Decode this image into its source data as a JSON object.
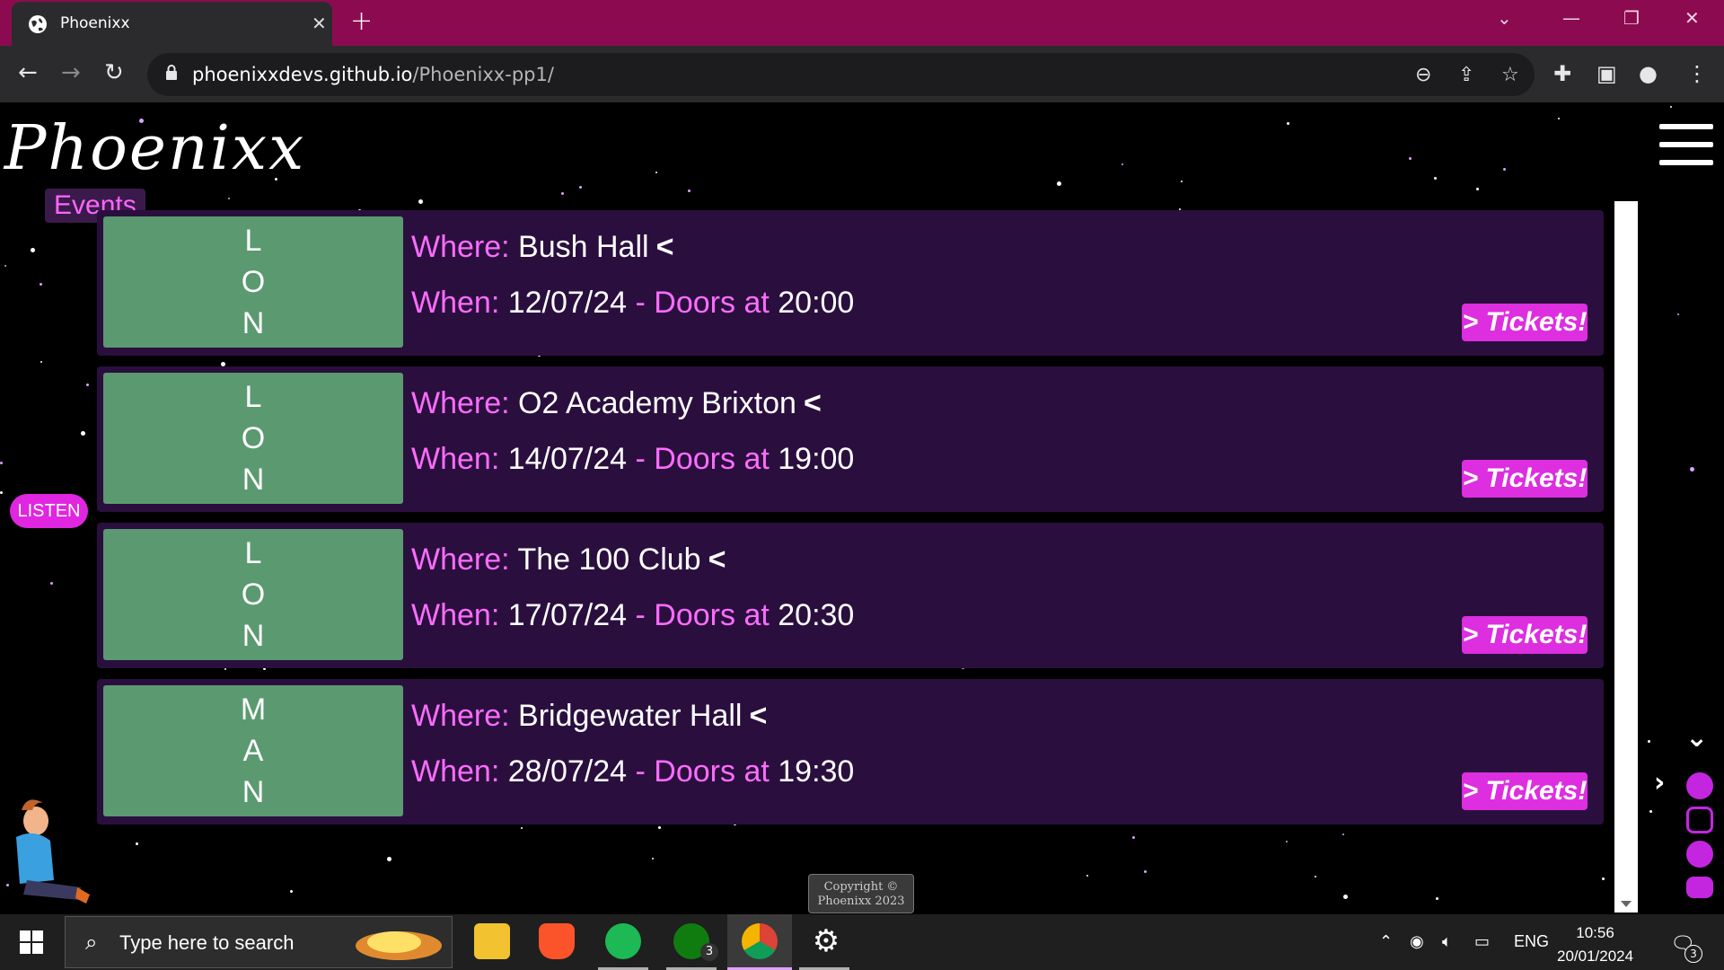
{
  "browser": {
    "tab_title": "Phoenixx",
    "url_host": "phoenixxdevs.github.io",
    "url_path": "/Phoenixx-pp1/"
  },
  "site": {
    "logo": "Phoenixx",
    "section_label": "Events",
    "listen_label": "LISTEN",
    "copyright_line1": "Copyright ©",
    "copyright_line2": "Phoenixx 2023"
  },
  "events": [
    {
      "city_letters": [
        "L",
        "O",
        "N"
      ],
      "where_label": "Where:",
      "venue": "Bush Hall",
      "when_label": "When:",
      "date": "12/07/24",
      "doors_label": "- Doors at",
      "time": "20:00",
      "tickets_label": "Tickets!"
    },
    {
      "city_letters": [
        "L",
        "O",
        "N"
      ],
      "where_label": "Where:",
      "venue": "O2 Academy Brixton",
      "when_label": "When:",
      "date": "14/07/24",
      "doors_label": "- Doors at",
      "time": "19:00",
      "tickets_label": "Tickets!"
    },
    {
      "city_letters": [
        "L",
        "O",
        "N"
      ],
      "where_label": "Where:",
      "venue": "The 100 Club",
      "when_label": "When:",
      "date": "17/07/24",
      "doors_label": "- Doors at",
      "time": "20:30",
      "tickets_label": "Tickets!"
    },
    {
      "city_letters": [
        "M",
        "A",
        "N"
      ],
      "where_label": "Where:",
      "venue": "Bridgewater Hall",
      "when_label": "When:",
      "date": "28/07/24",
      "doors_label": "- Doors at",
      "time": "19:30",
      "tickets_label": "Tickets!"
    }
  ],
  "taskbar": {
    "search_placeholder": "Type here to search",
    "xbox_badge": "3",
    "language": "ENG",
    "time": "10:56",
    "date": "20/01/2024",
    "notification_count": "3"
  },
  "colors": {
    "tab_bar": "#8c0b50",
    "card_bg": "#2a0f3e",
    "city_tile": "#5b9a70",
    "accent_pink": "#ff6cff",
    "button_magenta": "#dd2ee0"
  }
}
